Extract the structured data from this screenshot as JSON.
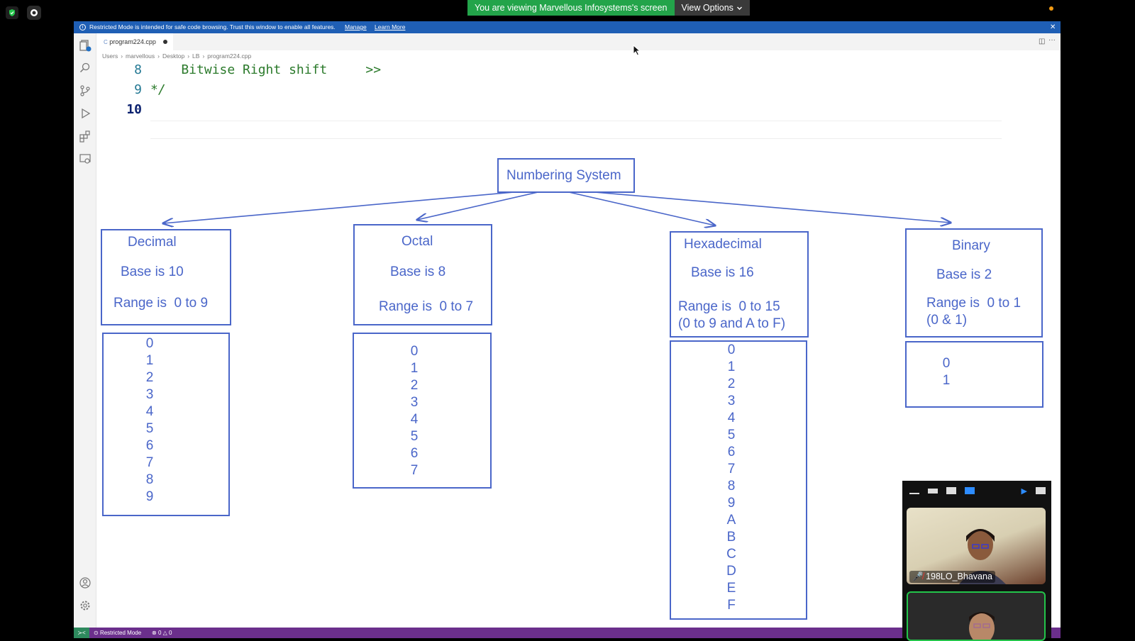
{
  "zoom": {
    "share_banner": "You are viewing Marvellous Infosystems's screen",
    "view_options": "View Options"
  },
  "restricted_bar": {
    "message": "Restricted Mode is intended for safe code browsing. Trust this window to enable all features.",
    "manage": "Manage",
    "learn_more": "Learn More"
  },
  "tab": {
    "filename": "program224.cpp"
  },
  "breadcrumb": [
    "Users",
    "marvellous",
    "Desktop",
    "LB",
    "program224.cpp"
  ],
  "code_lines": [
    {
      "number": "8",
      "text": "    Bitwise Right shift     >>"
    },
    {
      "number": "9",
      "text": "*/"
    },
    {
      "number": "10",
      "text": ""
    }
  ],
  "diagram": {
    "root": "Numbering System",
    "decimal": {
      "name": "Decimal",
      "base": "Base is 10",
      "range": "Range is  0 to 9",
      "digits": [
        "0",
        "1",
        "2",
        "3",
        "4",
        "5",
        "6",
        "7",
        "8",
        "9"
      ]
    },
    "octal": {
      "name": "Octal",
      "base": "Base is 8",
      "range": "Range is  0 to 7",
      "digits": [
        "0",
        "1",
        "2",
        "3",
        "4",
        "5",
        "6",
        "7"
      ]
    },
    "hexadecimal": {
      "name": "Hexadecimal",
      "base": "Base is 16",
      "range": "Range is  0 to 15",
      "range_detail": "(0 to 9 and A to F)",
      "digits": [
        "0",
        "1",
        "2",
        "3",
        "4",
        "5",
        "6",
        "7",
        "8",
        "9",
        "A",
        "B",
        "C",
        "D",
        "E",
        "F"
      ]
    },
    "binary": {
      "name": "Binary",
      "base": "Base is 2",
      "range": "Range is  0 to 1",
      "range_detail": "(0 & 1)",
      "digits": [
        "0",
        "1"
      ]
    }
  },
  "status_bar": {
    "restricted": "Restricted Mode",
    "problems": "0 △ 0"
  },
  "video": {
    "participant_1": "198LO_Bhavana"
  },
  "colors": {
    "diagram_blue": "#4a66c9",
    "code_green": "#2b7a2b",
    "status_purple": "#6b2f8c",
    "banner_green": "#23a44a"
  }
}
